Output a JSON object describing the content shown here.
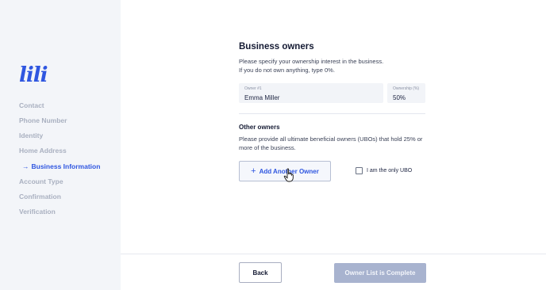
{
  "brand": {
    "logo_text": "lili",
    "accent": "#2f56e0"
  },
  "sidebar": {
    "items": [
      {
        "label": "Contact"
      },
      {
        "label": "Phone Number"
      },
      {
        "label": "Identity"
      },
      {
        "label": "Home Address"
      },
      {
        "label": "Business Information",
        "active": true,
        "indicator": "→"
      },
      {
        "label": "Account Type"
      },
      {
        "label": "Confirmation"
      },
      {
        "label": "Verification"
      }
    ]
  },
  "main": {
    "title": "Business owners",
    "subtitle_line1": "Please specify your ownership interest in the business.",
    "subtitle_line2": "If you do not own anything, type 0%.",
    "owner_field": {
      "label": "Owner #1",
      "value": "Emma Miller"
    },
    "ownership_field": {
      "label": "Ownership (%)",
      "value": "50%"
    },
    "other_owners_title": "Other owners",
    "other_owners_desc": "Please provide all ultimate beneficial owners (UBOs) that hold 25% or more of the business.",
    "add_owner_button": {
      "icon": "+",
      "label": "Add Another Owner"
    },
    "only_ubo_checkbox": {
      "label": "I am the only UBO",
      "checked": false
    }
  },
  "footer": {
    "back_label": "Back",
    "complete_label": "Owner List is Complete"
  }
}
